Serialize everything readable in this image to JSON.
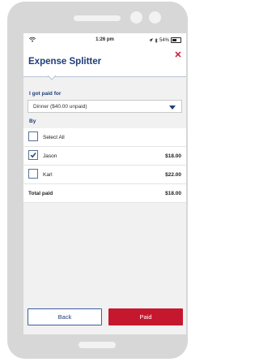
{
  "status_bar": {
    "time": "1:26 pm",
    "battery": "54%",
    "icons": [
      "wifi-icon",
      "location-icon",
      "bluetooth-icon",
      "battery-icon"
    ]
  },
  "header": {
    "title": "Expense Splitter",
    "close_icon": "close-icon"
  },
  "form": {
    "paid_for_label": "I got paid for",
    "paid_for_value": "Dinner ($40.00 unpaid)",
    "by_label": "By"
  },
  "people": {
    "select_all_label": "Select All",
    "select_all_checked": false,
    "rows": [
      {
        "name": "Jason",
        "amount": "$18.00",
        "checked": true
      },
      {
        "name": "Karl",
        "amount": "$22.00",
        "checked": false
      }
    ],
    "total_label": "Total paid",
    "total_amount": "$18.00"
  },
  "buttons": {
    "back_label": "Back",
    "paid_label": "Paid"
  },
  "colors": {
    "brand_blue": "#1f3c7a",
    "accent_red": "#c5182f",
    "screen_bg": "#f1f1f1",
    "device_frame": "#d7d7d7"
  }
}
